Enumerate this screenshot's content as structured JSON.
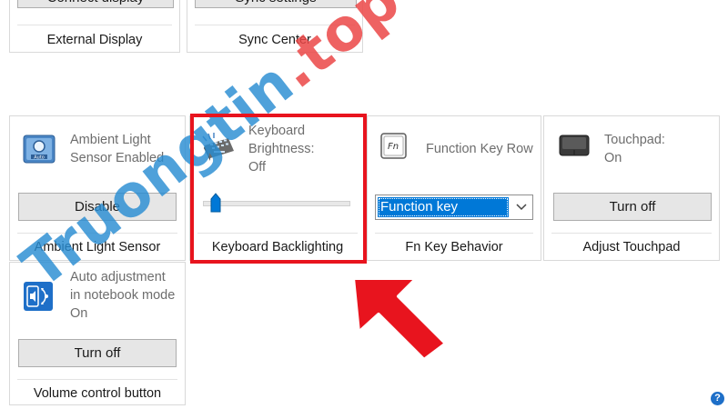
{
  "top_tiles": [
    {
      "button": "Connect display",
      "title": "External Display"
    },
    {
      "button": "Sync settings",
      "title": "Sync Center"
    }
  ],
  "ambient": {
    "status": "Ambient Light Sensor Enabled",
    "button": "Disable",
    "title": "Ambient Light Sensor"
  },
  "keyboard": {
    "status": "Keyboard Brightness: Off",
    "title": "Keyboard Backlighting",
    "brightness_level": 0.05
  },
  "fnkey": {
    "status": "Function Key Row",
    "selected": "Function key",
    "title": "Fn Key Behavior",
    "icon_text": "Fn"
  },
  "touchpad": {
    "status": "Touchpad: On",
    "button": "Turn off",
    "title": "Adjust Touchpad"
  },
  "volume": {
    "status": "Auto adjustment in notebook mode On",
    "button": "Turn off",
    "title": "Volume control button"
  },
  "watermark": {
    "text1": "Truongtin",
    "text2": ".top"
  },
  "help": {
    "symbol": "?"
  },
  "colors": {
    "highlight": "#e8141e",
    "arrow": "#e8141e",
    "selection": "#0078d7",
    "icon_blue": "#1e6fc8"
  }
}
